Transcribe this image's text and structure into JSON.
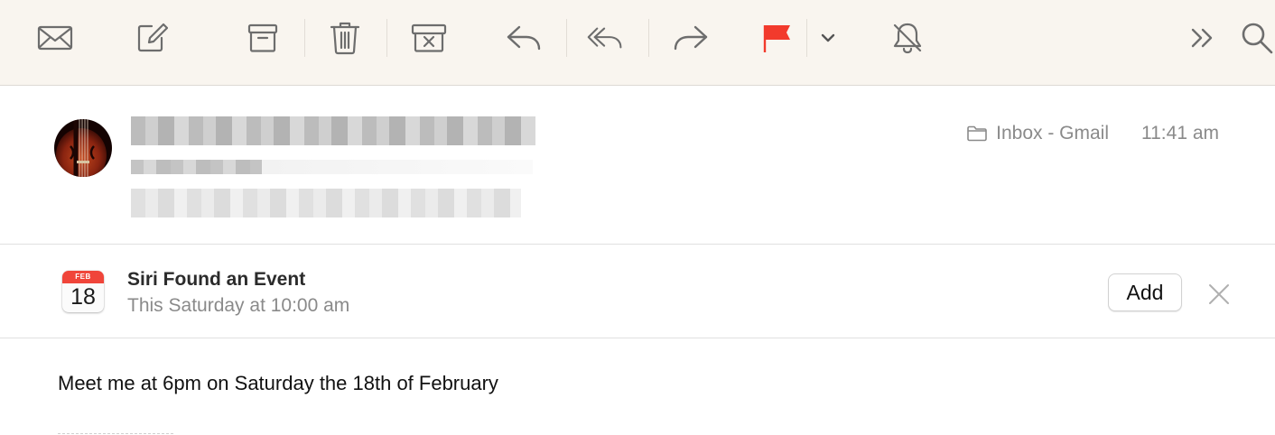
{
  "toolbar": {
    "icons": [
      "envelope-icon",
      "compose-icon",
      "archive-icon",
      "trash-icon",
      "junk-icon",
      "reply-icon",
      "reply-all-icon",
      "forward-icon",
      "flag-icon",
      "chevron-down-icon",
      "mute-icon",
      "more-icon",
      "search-icon"
    ],
    "flag_color": "#f23a2c"
  },
  "message": {
    "mailbox": "Inbox - Gmail",
    "time": "11:41 am"
  },
  "siri_event": {
    "icon": "calendar-icon",
    "month": "FEB",
    "day": "18",
    "title": "Siri Found an Event",
    "subtitle": "This Saturday at 10:00 am",
    "add_label": "Add"
  },
  "body": {
    "text": "Meet me at 6pm on Saturday the 18th of February"
  }
}
